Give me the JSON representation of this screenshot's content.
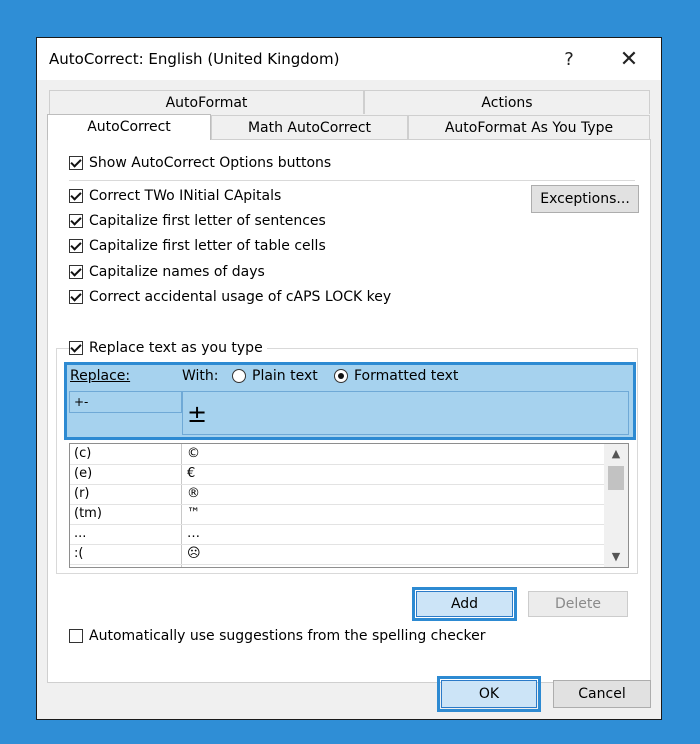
{
  "window": {
    "title": "AutoCorrect: English (United Kingdom)",
    "help_glyph": "?",
    "close_glyph": "✕"
  },
  "tabs": {
    "back_row": [
      "AutoFormat",
      "Actions"
    ],
    "front_row": [
      "AutoCorrect",
      "Math AutoCorrect",
      "AutoFormat As You Type"
    ],
    "active": "AutoCorrect"
  },
  "options": {
    "show_buttons": {
      "label": "Show AutoCorrect Options buttons",
      "checked": true
    },
    "two_initial_caps": {
      "label": "Correct TWo INitial CApitals",
      "checked": true
    },
    "first_letter_sentences": {
      "label": "Capitalize first letter of sentences",
      "checked": true
    },
    "first_letter_table_cells": {
      "label": "Capitalize first letter of table cells",
      "checked": true
    },
    "names_of_days": {
      "label": "Capitalize names of days",
      "checked": true
    },
    "caps_lock": {
      "label": "Correct accidental usage of cAPS LOCK key",
      "checked": true
    },
    "replace_text": {
      "label": "Replace text as you type",
      "checked": true
    },
    "spelling_suggestions": {
      "label": "Automatically use suggestions from the spelling checker",
      "checked": false
    }
  },
  "exceptions_label": "Exceptions...",
  "replace_section": {
    "replace_label": "Replace:",
    "with_label": "With:",
    "plain_text_label": "Plain text",
    "formatted_text_label": "Formatted text",
    "selected_mode": "formatted",
    "replace_value": "+-",
    "with_value": "±"
  },
  "entries": [
    {
      "replace": "(c)",
      "with": "©"
    },
    {
      "replace": "(e)",
      "with": "€"
    },
    {
      "replace": "(r)",
      "with": "®"
    },
    {
      "replace": "(tm)",
      "with": "™"
    },
    {
      "replace": "...",
      "with": "…"
    },
    {
      "replace": ":(",
      "with": "☹"
    }
  ],
  "buttons": {
    "add": "Add",
    "delete": "Delete",
    "ok": "OK",
    "cancel": "Cancel"
  },
  "colors": {
    "highlight": "#a6d2ee",
    "highlight_border": "#2d8ad2",
    "background": "#2f8ed6"
  }
}
